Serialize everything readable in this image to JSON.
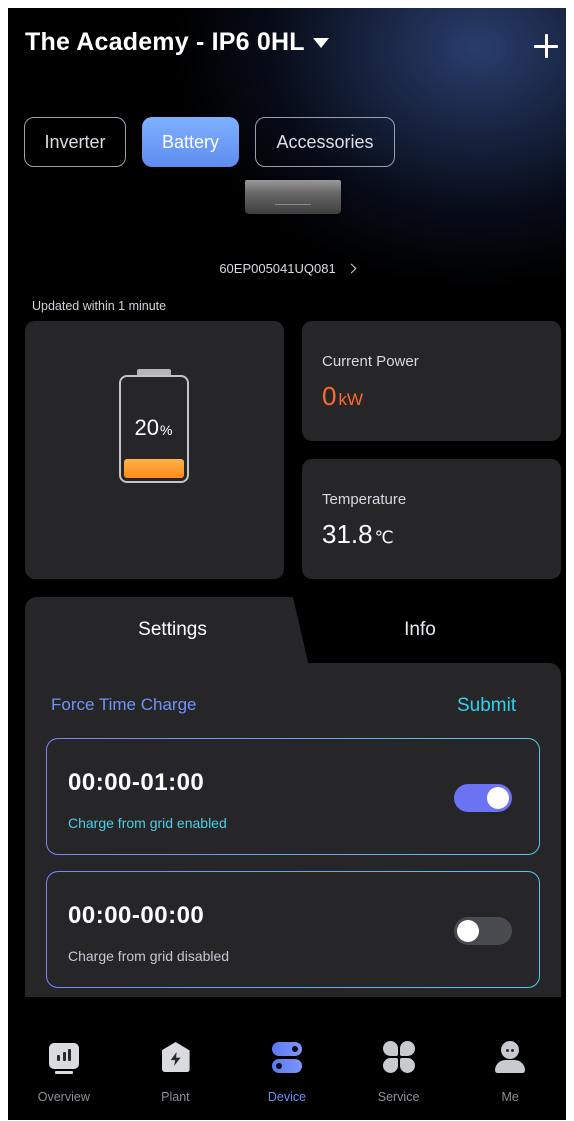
{
  "header": {
    "title": "The Academy - IP6 0HL"
  },
  "device_tabs": [
    {
      "label": "Inverter",
      "active": false
    },
    {
      "label": "Battery",
      "active": true
    },
    {
      "label": "Accessories",
      "active": false
    }
  ],
  "device": {
    "serial": "60EP005041UQ081"
  },
  "status": {
    "updated": "Updated  within 1 minute"
  },
  "battery": {
    "percent": "20",
    "percent_unit": "%",
    "fill_fraction": 0.2
  },
  "power": {
    "label": "Current Power",
    "value": "0",
    "unit": "kW"
  },
  "temperature": {
    "label": "Temperature",
    "value": "31.8",
    "unit": "℃"
  },
  "panel": {
    "tabs": [
      {
        "label": "Settings",
        "active": true
      },
      {
        "label": "Info",
        "active": false
      }
    ],
    "section_title": "Force Time Charge",
    "submit_label": "Submit",
    "slots": [
      {
        "time": "00:00-01:00",
        "note": "Charge from grid enabled",
        "enabled": true
      },
      {
        "time": "00:00-00:00",
        "note": "Charge from grid disabled",
        "enabled": false
      }
    ]
  },
  "nav": [
    {
      "label": "Overview",
      "icon": "overview-icon",
      "active": false
    },
    {
      "label": "Plant",
      "icon": "plant-icon",
      "active": false
    },
    {
      "label": "Device",
      "icon": "device-icon",
      "active": true
    },
    {
      "label": "Service",
      "icon": "service-icon",
      "active": false
    },
    {
      "label": "Me",
      "icon": "me-icon",
      "active": false
    }
  ],
  "colors": {
    "accent_blue": "#6f8ef6",
    "power_orange": "#ff6a2a",
    "submit_cyan": "#2fd1ee",
    "battery_fill": "#ff8a1a",
    "toggle_on": "#6b72f4"
  }
}
